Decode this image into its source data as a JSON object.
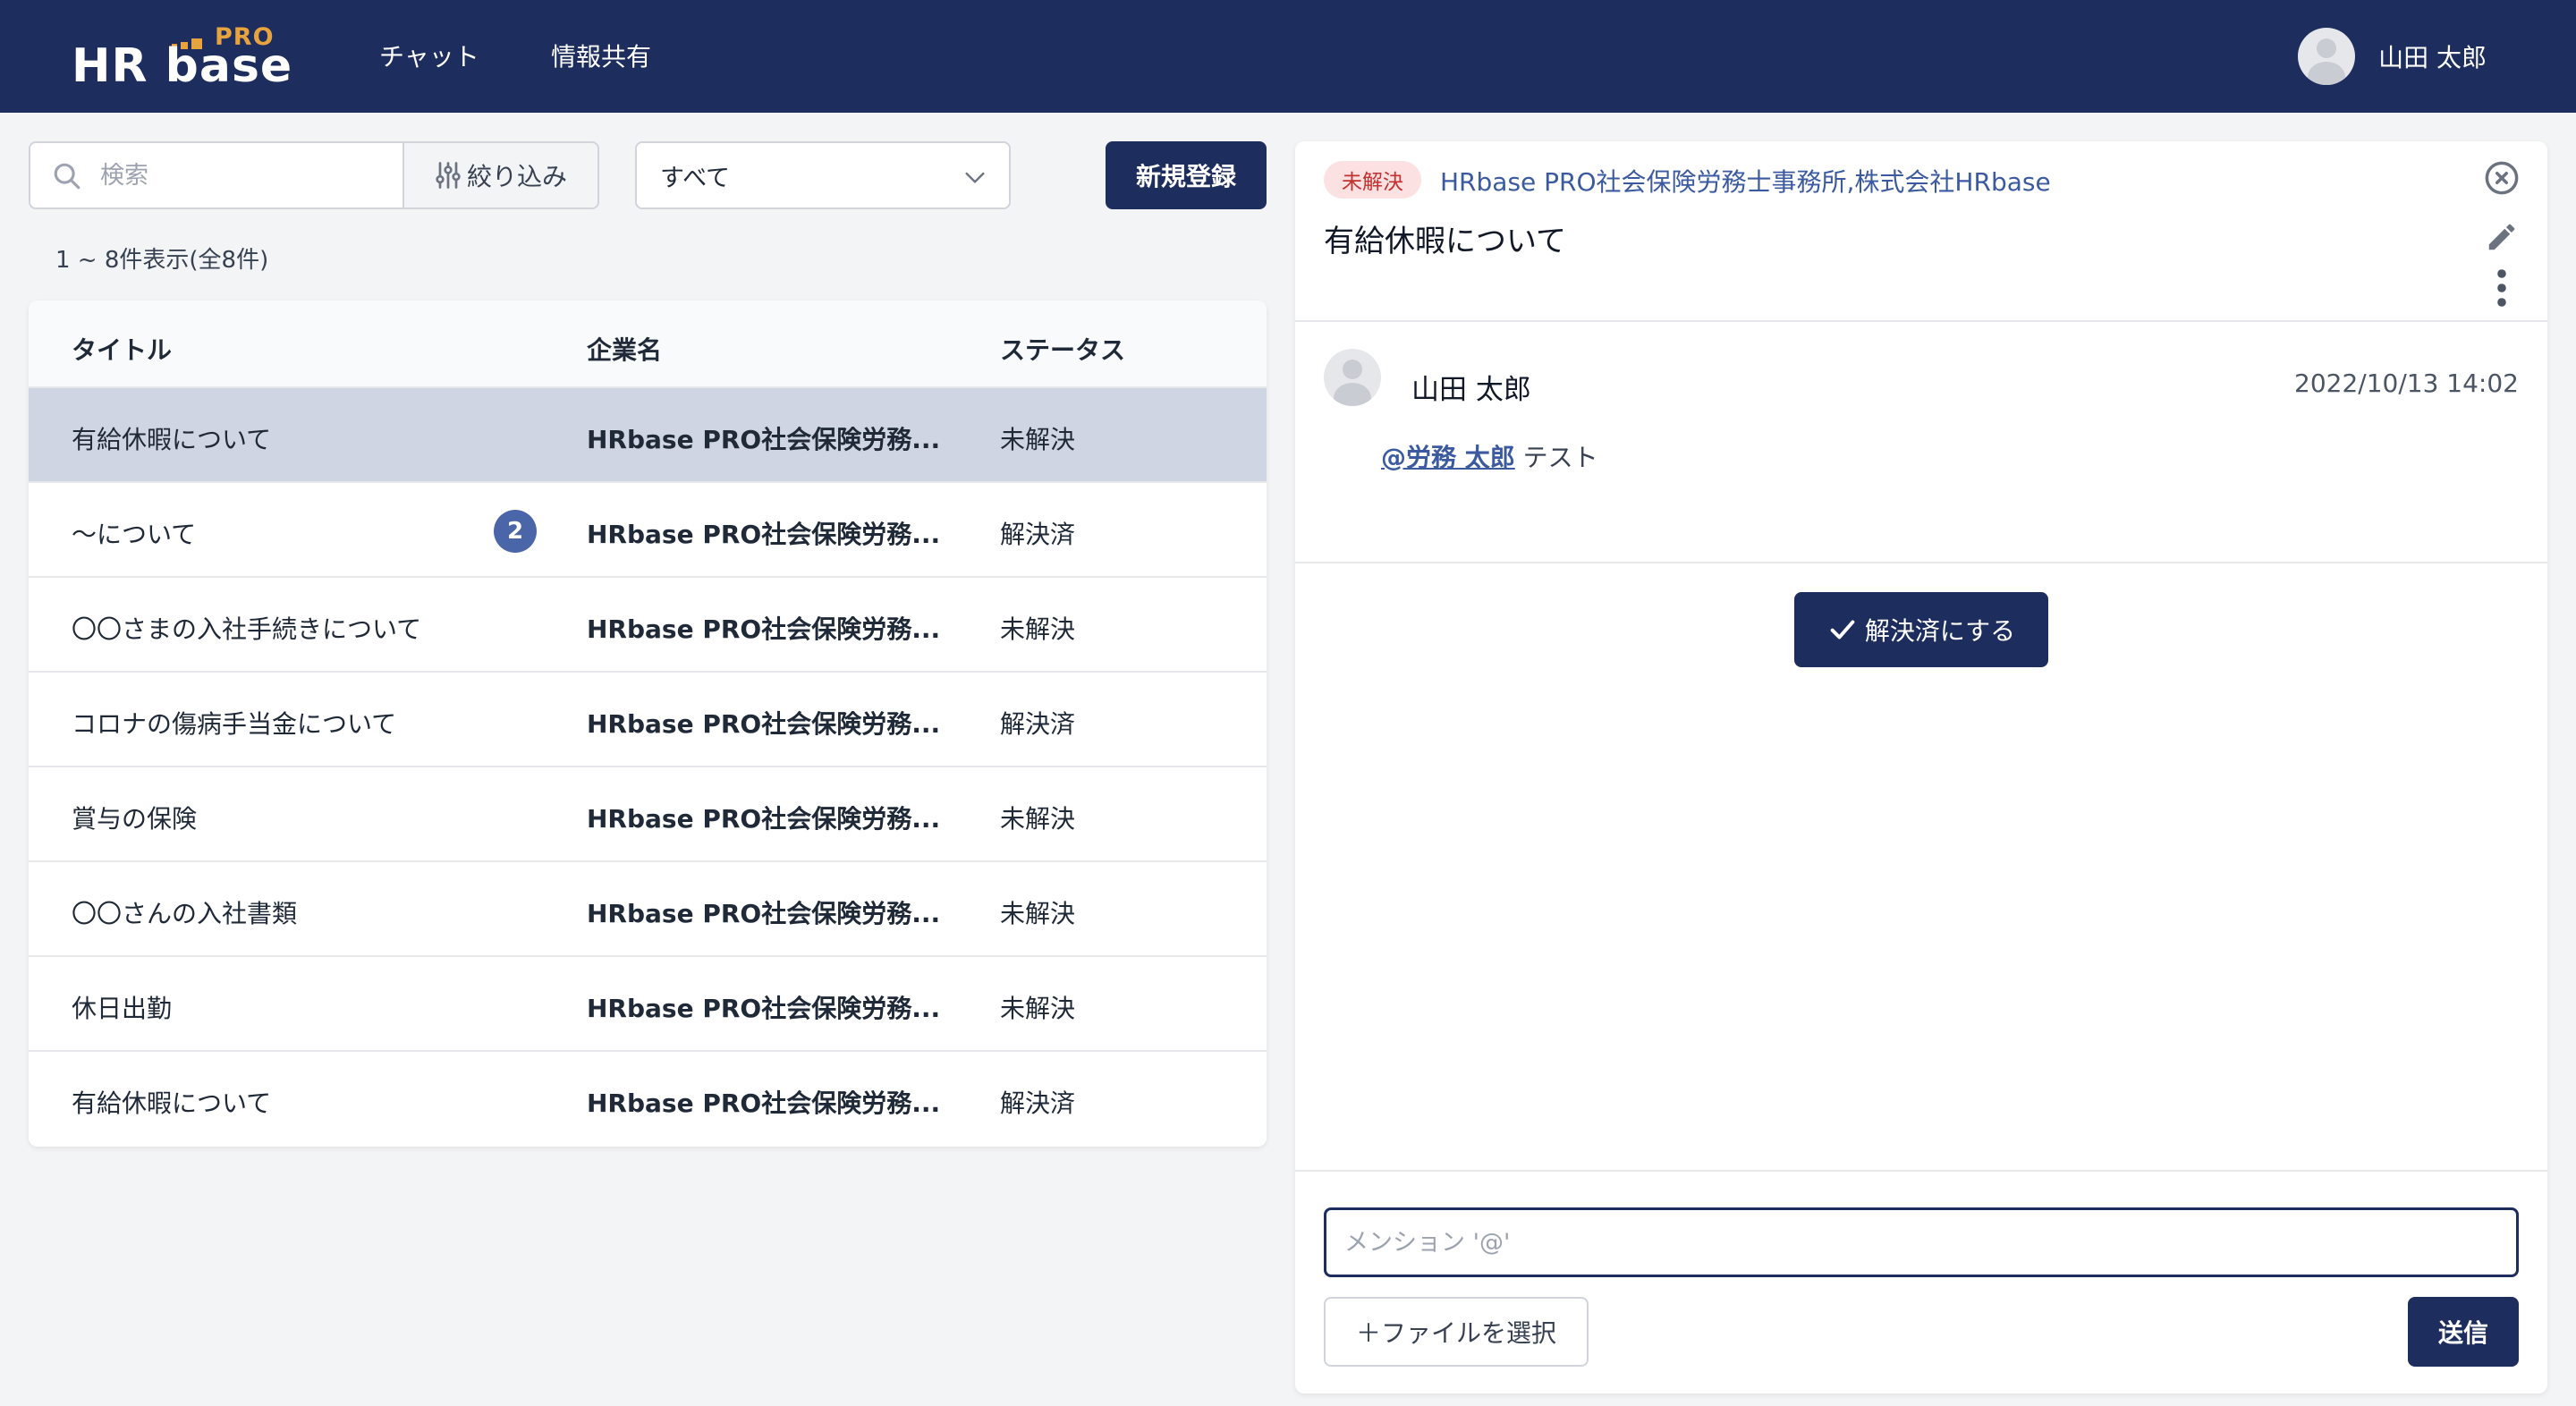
{
  "header": {
    "logo_main": "HR base",
    "logo_pro": "PRO",
    "nav": [
      "チャット",
      "情報共有"
    ],
    "user_name": "山田 太郎"
  },
  "toolbar": {
    "search_placeholder": "検索",
    "filter_label": "絞り込み",
    "select_value": "すべて",
    "new_button": "新規登録",
    "count_text": "1 ~ 8件表示(全8件)"
  },
  "table": {
    "headers": [
      "タイトル",
      "企業名",
      "ステータス"
    ],
    "rows": [
      {
        "title": "有給休暇について",
        "company": "HRbase PRO社会保険労務...",
        "status": "未解決",
        "badge": ""
      },
      {
        "title": "〜について",
        "company": "HRbase PRO社会保険労務...",
        "status": "解決済",
        "badge": "2"
      },
      {
        "title": "〇〇さまの入社手続きについて",
        "company": "HRbase PRO社会保険労務...",
        "status": "未解決",
        "badge": ""
      },
      {
        "title": "コロナの傷病手当金について",
        "company": "HRbase PRO社会保険労務...",
        "status": "解決済",
        "badge": ""
      },
      {
        "title": "賞与の保険",
        "company": "HRbase PRO社会保険労務...",
        "status": "未解決",
        "badge": ""
      },
      {
        "title": "〇〇さんの入社書類",
        "company": "HRbase PRO社会保険労務...",
        "status": "未解決",
        "badge": ""
      },
      {
        "title": "休日出勤",
        "company": "HRbase PRO社会保険労務...",
        "status": "未解決",
        "badge": ""
      },
      {
        "title": "有給休暇について",
        "company": "HRbase PRO社会保険労務...",
        "status": "解決済",
        "badge": ""
      }
    ]
  },
  "detail": {
    "status": "未解決",
    "company": "HRbase PRO社会保険労務士事務所,株式会社HRbase",
    "title": "有給休暇について",
    "message": {
      "author": "山田 太郎",
      "time": "2022/10/13 14:02",
      "mention": "@労務 太郎",
      "text": " テスト"
    },
    "resolve_button": "解決済にする",
    "input_placeholder": "メンション '@'",
    "file_button": "＋ファイルを選択",
    "send_button": "送信"
  },
  "colors": {
    "brand_navy": "#1c2d5e",
    "logo_accent": "#e7a33e",
    "link_blue": "#3b5aa0",
    "unresolved_red": "#c53030",
    "selected_row": "#cfd5e2"
  },
  "icons": [
    "search-icon",
    "filter-sliders-icon",
    "chevron-down-icon",
    "close-circle-icon",
    "pencil-icon",
    "more-vertical-icon",
    "check-icon",
    "user-avatar-icon"
  ]
}
